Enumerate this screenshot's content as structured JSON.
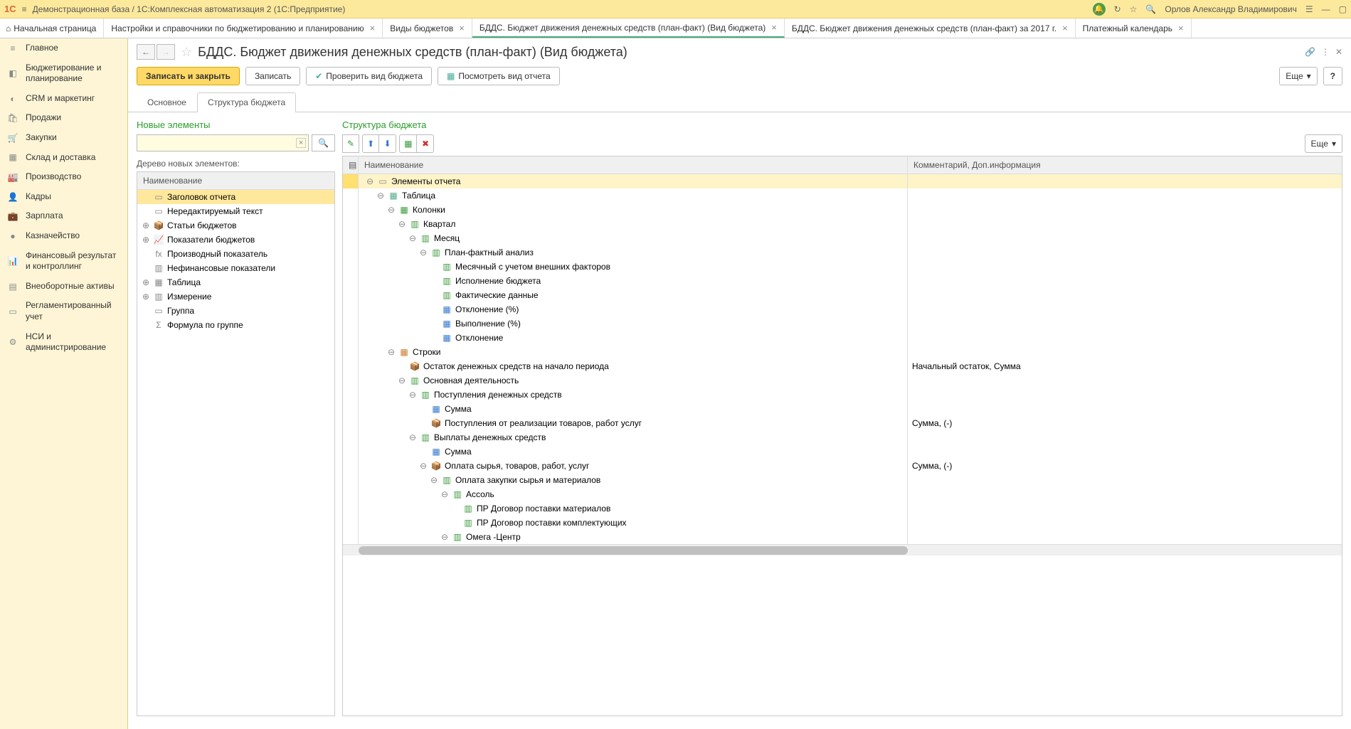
{
  "titlebar": {
    "logo": "1С",
    "title": "Демонстрационная база / 1С:Комплексная автоматизация 2  (1С:Предприятие)",
    "username": "Орлов Александр Владимирович"
  },
  "navtabs": [
    {
      "label": "Начальная страница",
      "home": true
    },
    {
      "label": "Настройки и справочники по бюджетированию и планированию",
      "close": true
    },
    {
      "label": "Виды  бюджетов",
      "close": true
    },
    {
      "label": "БДДС. Бюджет движения денежных средств (план-факт) (Вид бюджета)",
      "close": true,
      "active": true
    },
    {
      "label": "БДДС. Бюджет движения денежных средств (план-факт)  за 2017 г.",
      "close": true
    },
    {
      "label": "Платежный календарь",
      "close": true
    }
  ],
  "sidebar": [
    {
      "icon": "≡",
      "label": "Главное"
    },
    {
      "icon": "◧",
      "label": "Бюджетирование и планирование"
    },
    {
      "icon": "◐",
      "label": "CRM и маркетинг"
    },
    {
      "icon": "🛍",
      "label": "Продажи"
    },
    {
      "icon": "🛒",
      "label": "Закупки"
    },
    {
      "icon": "▦",
      "label": "Склад и доставка"
    },
    {
      "icon": "🏭",
      "label": "Производство"
    },
    {
      "icon": "👤",
      "label": "Кадры"
    },
    {
      "icon": "💼",
      "label": "Зарплата"
    },
    {
      "icon": "●",
      "label": "Казначейство"
    },
    {
      "icon": "📊",
      "label": "Финансовый результат и контроллинг"
    },
    {
      "icon": "▤",
      "label": "Внеоборотные активы"
    },
    {
      "icon": "▭",
      "label": "Регламентированный учет"
    },
    {
      "icon": "⚙",
      "label": "НСИ и администрирование"
    }
  ],
  "page_title": "БДДС. Бюджет движения денежных средств (план-факт) (Вид бюджета)",
  "cmd": {
    "save_close": "Записать и закрыть",
    "save": "Записать",
    "check": "Проверить вид бюджета",
    "preview": "Посмотреть вид отчета",
    "more": "Еще",
    "help": "?"
  },
  "subtabs": {
    "main": "Основное",
    "structure": "Структура бюджета"
  },
  "left": {
    "title": "Новые элементы",
    "search_placeholder": "",
    "tree_label": "Дерево новых элементов:",
    "header": "Наименование",
    "rows": [
      {
        "indent": 0,
        "exp": "",
        "icon": "▭",
        "label": "Заголовок отчета",
        "selected": true
      },
      {
        "indent": 0,
        "exp": "",
        "icon": "▭",
        "label": "Нередактируемый текст"
      },
      {
        "indent": 0,
        "exp": "⊕",
        "icon": "📦",
        "label": "Статьи бюджетов"
      },
      {
        "indent": 0,
        "exp": "⊕",
        "icon": "📈",
        "label": "Показатели бюджетов"
      },
      {
        "indent": 0,
        "exp": "",
        "icon": "fx",
        "label": "Производный показатель"
      },
      {
        "indent": 0,
        "exp": "",
        "icon": "▥",
        "label": "Нефинансовые показатели"
      },
      {
        "indent": 0,
        "exp": "⊕",
        "icon": "▦",
        "label": "Таблица"
      },
      {
        "indent": 0,
        "exp": "⊕",
        "icon": "▥",
        "label": "Измерение"
      },
      {
        "indent": 0,
        "exp": "",
        "icon": "▭",
        "label": "Группа"
      },
      {
        "indent": 0,
        "exp": "",
        "icon": "Σ",
        "label": "Формула по группе"
      }
    ]
  },
  "right": {
    "title": "Структура бюджета",
    "more": "Еще",
    "header": {
      "name": "Наименование",
      "comment": "Комментарий, Доп.информация"
    },
    "rows": [
      {
        "indent": 0,
        "exp": "⊖",
        "icon": "▭",
        "iclass": "ic-gray",
        "label": "Элементы отчета",
        "sel": true
      },
      {
        "indent": 1,
        "exp": "⊖",
        "icon": "▦",
        "iclass": "ic-table",
        "label": "Таблица"
      },
      {
        "indent": 2,
        "exp": "⊖",
        "icon": "▦",
        "iclass": "ic-green",
        "label": "Колонки"
      },
      {
        "indent": 3,
        "exp": "⊖",
        "icon": "▥",
        "iclass": "ic-green",
        "label": "Квартал"
      },
      {
        "indent": 4,
        "exp": "⊖",
        "icon": "▥",
        "iclass": "ic-green",
        "label": "Месяц"
      },
      {
        "indent": 5,
        "exp": "⊖",
        "icon": "▥",
        "iclass": "ic-green",
        "label": "План-фактный анализ"
      },
      {
        "indent": 6,
        "exp": "",
        "icon": "▥",
        "iclass": "ic-green",
        "label": "Месячный с учетом внешних факторов"
      },
      {
        "indent": 6,
        "exp": "",
        "icon": "▥",
        "iclass": "ic-green",
        "label": "Исполнение бюджета"
      },
      {
        "indent": 6,
        "exp": "",
        "icon": "▥",
        "iclass": "ic-green",
        "label": "Фактические данные"
      },
      {
        "indent": 6,
        "exp": "",
        "icon": "▦",
        "iclass": "ic-blue",
        "label": "Отклонение (%)"
      },
      {
        "indent": 6,
        "exp": "",
        "icon": "▦",
        "iclass": "ic-blue",
        "label": "Выполнение (%)"
      },
      {
        "indent": 6,
        "exp": "",
        "icon": "▦",
        "iclass": "ic-blue",
        "label": "Отклонение"
      },
      {
        "indent": 2,
        "exp": "⊖",
        "icon": "▦",
        "iclass": "ic-orange",
        "label": "Строки"
      },
      {
        "indent": 3,
        "exp": "",
        "icon": "📦",
        "iclass": "ic-brown",
        "label": "Остаток денежных средств на начало периода",
        "comment": "Начальный остаток, Сумма"
      },
      {
        "indent": 3,
        "exp": "⊖",
        "icon": "▥",
        "iclass": "ic-green",
        "label": "Основная деятельность"
      },
      {
        "indent": 4,
        "exp": "⊖",
        "icon": "▥",
        "iclass": "ic-green",
        "label": "Поступления денежных средств"
      },
      {
        "indent": 5,
        "exp": "",
        "icon": "▦",
        "iclass": "ic-blue",
        "label": "Сумма"
      },
      {
        "indent": 5,
        "exp": "",
        "icon": "📦",
        "iclass": "ic-orange",
        "label": "Поступления от реализации товаров, работ услуг",
        "comment": "Сумма, (-)"
      },
      {
        "indent": 4,
        "exp": "⊖",
        "icon": "▥",
        "iclass": "ic-green",
        "label": "Выплаты денежных средств"
      },
      {
        "indent": 5,
        "exp": "",
        "icon": "▦",
        "iclass": "ic-blue",
        "label": "Сумма"
      },
      {
        "indent": 5,
        "exp": "⊖",
        "icon": "📦",
        "iclass": "ic-orange",
        "label": "Оплата сырья, товаров, работ, услуг",
        "comment": "Сумма, (-)"
      },
      {
        "indent": 6,
        "exp": "⊖",
        "icon": "▥",
        "iclass": "ic-green",
        "label": "Оплата закупки сырья и материалов"
      },
      {
        "indent": 7,
        "exp": "⊖",
        "icon": "▥",
        "iclass": "ic-green",
        "label": "Ассоль"
      },
      {
        "indent": 8,
        "exp": "",
        "icon": "▥",
        "iclass": "ic-green",
        "label": "ПР Договор поставки материалов"
      },
      {
        "indent": 8,
        "exp": "",
        "icon": "▥",
        "iclass": "ic-green",
        "label": "ПР Договор поставки комплектующих"
      },
      {
        "indent": 7,
        "exp": "⊖",
        "icon": "▥",
        "iclass": "ic-green",
        "label": "Омега -Центр"
      }
    ]
  }
}
